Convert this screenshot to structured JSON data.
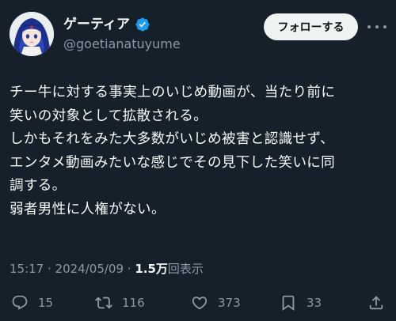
{
  "author": {
    "display_name": "ゲーティア",
    "handle": "@goetianatuyume",
    "verified_icon": "verified-badge-icon"
  },
  "header": {
    "follow_label": "フォローする",
    "more_icon": "more-options-icon"
  },
  "tweet": {
    "lines": [
      "チー牛に対する事実上のいじめ動画が、当たり前に",
      "笑いの対象として拡散される。",
      "しかもそれをみた大多数がいじめ被害と認識せず、",
      "エンタメ動画みたいな感じでその見下した笑いに同",
      "調する。",
      "弱者男性に人権がない。"
    ]
  },
  "meta": {
    "time": "15:17",
    "separator1": " · ",
    "date": "2024/05/09",
    "separator2": " · ",
    "views_count": "1.5万",
    "views_label": "回表示"
  },
  "actions": {
    "replies": "15",
    "reposts": "116",
    "likes": "373",
    "bookmarks": "33"
  },
  "colors": {
    "background": "#15202b",
    "text": "#f7f9f9",
    "secondary": "#8b98a5",
    "verified": "#1d9bf0",
    "button_bg": "#eff3f4"
  }
}
